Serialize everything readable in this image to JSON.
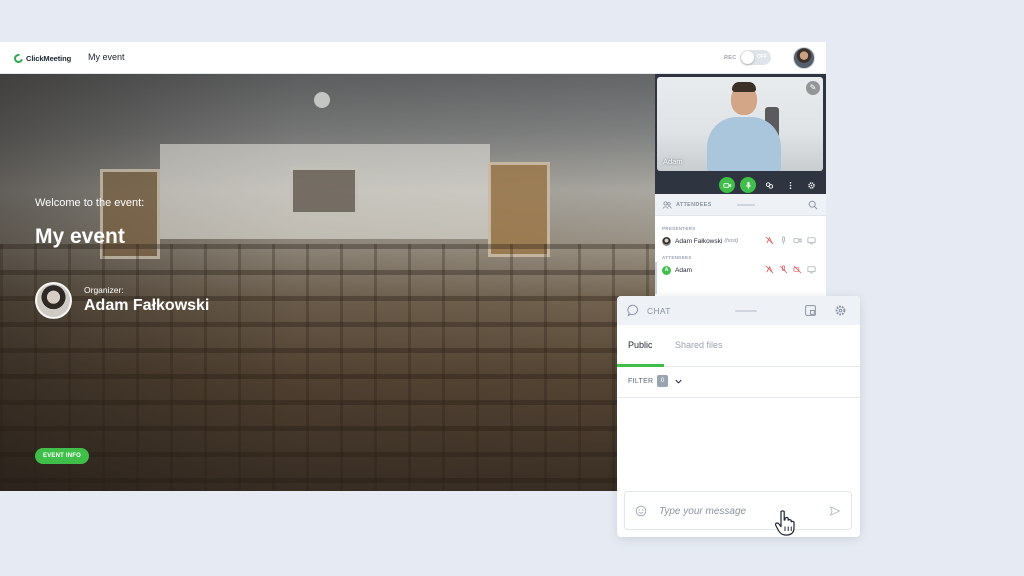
{
  "header": {
    "logo_text": "ClickMeeting",
    "event_title": "My event",
    "rec_label": "REC",
    "rec_state": "OFF"
  },
  "stage": {
    "welcome": "Welcome to the event:",
    "title": "My event",
    "organizer_label": "Organizer:",
    "organizer_name": "Adam Fałkowski",
    "event_info_button": "EVENT INFO"
  },
  "video": {
    "participant_name": "Adam"
  },
  "attendees": {
    "title": "ATTENDEES",
    "presenters_label": "PRESENTERS",
    "attendees_label": "ATTENDEES",
    "presenters": [
      {
        "name": "Adam Fałkowski",
        "role": "(host)"
      }
    ],
    "list": [
      {
        "name": "Adam",
        "initial": "A"
      }
    ]
  },
  "chat": {
    "title": "CHAT",
    "tabs": [
      "Public",
      "Shared files"
    ],
    "active_tab": "Public",
    "filter_label": "FILTER",
    "filter_count": "0",
    "message_placeholder": "Type your message"
  },
  "colors": {
    "accent_green": "#3fbf4a",
    "background": "#e6ebf3"
  }
}
